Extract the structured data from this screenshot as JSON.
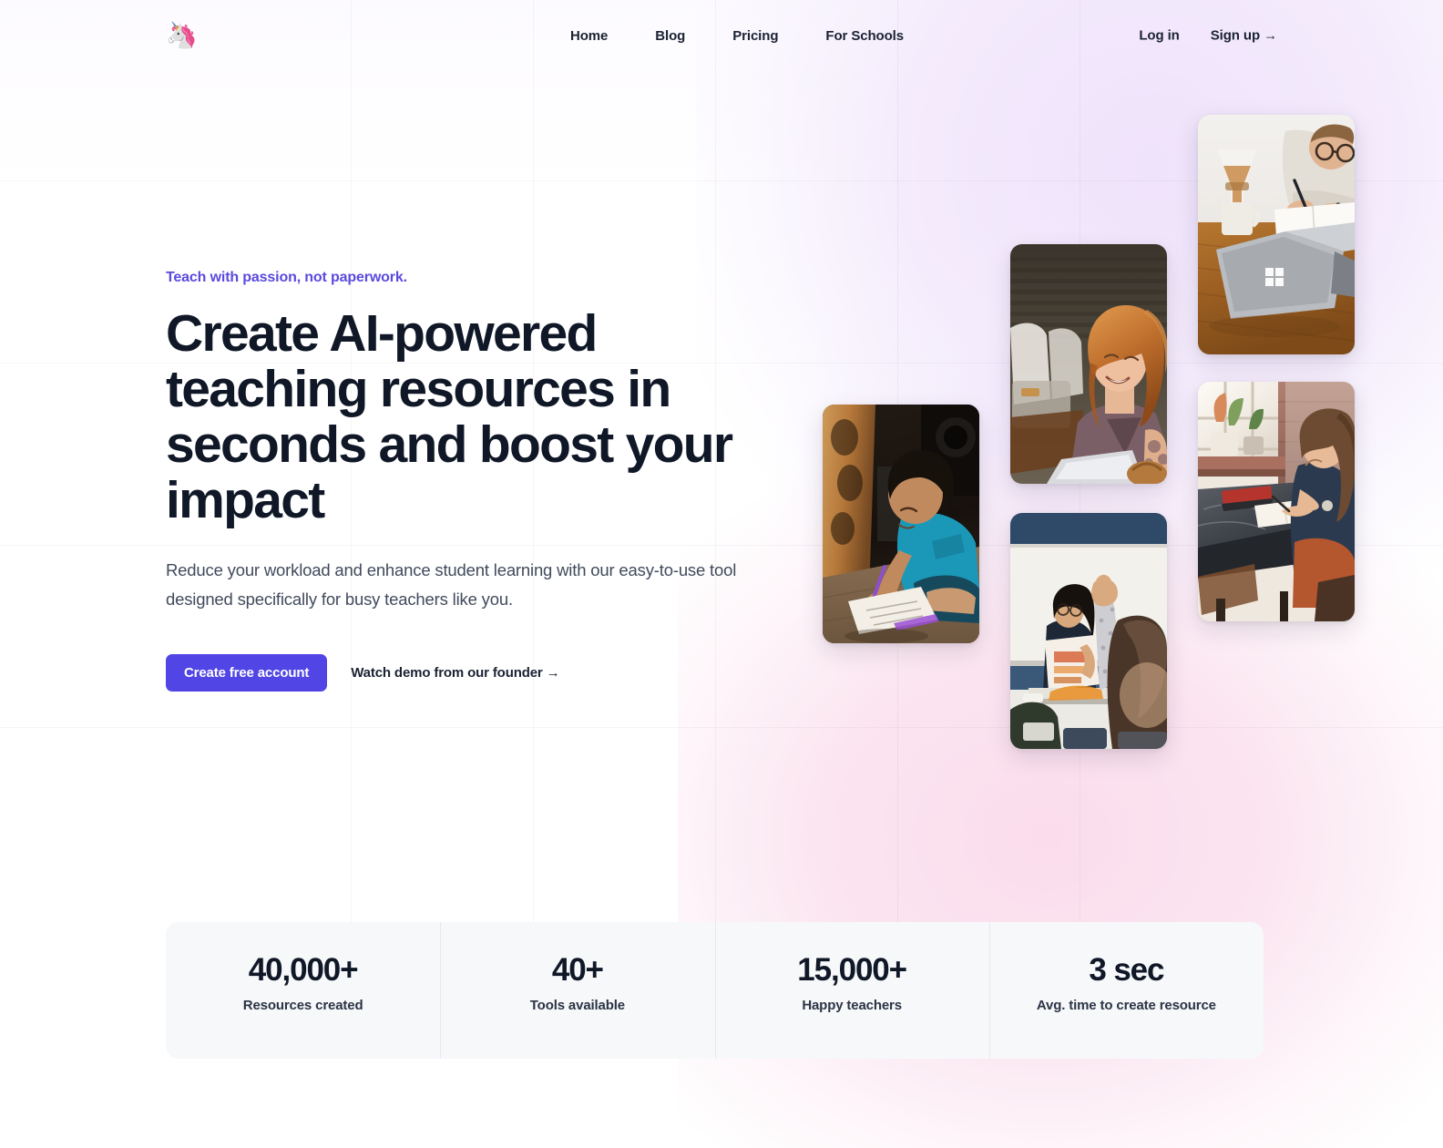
{
  "header": {
    "logo_glyph": "🦄",
    "logo_name": "unicorn-logo",
    "nav": [
      {
        "label": "Home"
      },
      {
        "label": "Blog"
      },
      {
        "label": "Pricing"
      },
      {
        "label": "For Schools"
      }
    ],
    "login_label": "Log in",
    "signup_label": "Sign up →"
  },
  "hero": {
    "eyebrow": "Teach with passion, not paperwork.",
    "title": "Create AI-powered teaching resources in seconds and boost your impact",
    "subtitle": "Reduce your workload and enhance student learning with our easy-to-use tool designed specifically for busy teachers like you.",
    "primary_cta": "Create free account",
    "secondary_cta": "Watch demo from our founder →"
  },
  "collage": {
    "photos": [
      {
        "name": "photo-man-writing-at-desk",
        "alt": "Man in glasses writing in a notebook beside a Surface laptop and coffee"
      },
      {
        "name": "photo-woman-smiling-at-laptop",
        "alt": "Red-haired woman smiling while working on a laptop in a cafe"
      },
      {
        "name": "photo-woman-studying-by-window",
        "alt": "Woman writing in a notebook at a marble table by a sunny window"
      },
      {
        "name": "photo-child-drawing-on-floor",
        "alt": "Young child sitting on the floor drawing on paper with a purple pencil"
      },
      {
        "name": "photo-classroom-raised-hand",
        "alt": "Student raising a hand in a classroom while the teacher holds a worksheet"
      }
    ]
  },
  "stats": [
    {
      "value": "40,000+",
      "label": "Resources created"
    },
    {
      "value": "40+",
      "label": "Tools available"
    },
    {
      "value": "15,000+",
      "label": "Happy teachers"
    },
    {
      "value": "3 sec",
      "label": "Avg. time to create resource"
    }
  ],
  "colors": {
    "accent_purple": "#5145e5",
    "eyebrow_purple": "#5b4ae0",
    "ink": "#101828",
    "body_text": "#414a5c",
    "stats_bg": "#f7f8fa",
    "wash_lavender": "#f3e9fb",
    "wash_pink": "#fbe4ef"
  }
}
